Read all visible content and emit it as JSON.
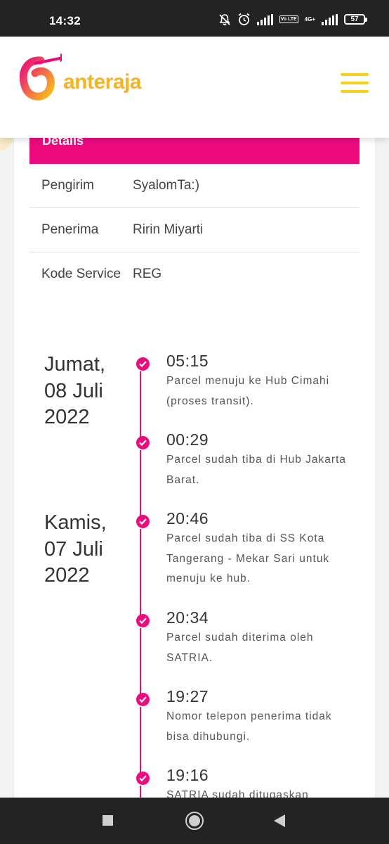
{
  "status": {
    "time": "14:32",
    "volte": "Vo LTE",
    "network": "4G+",
    "battery": "57"
  },
  "header": {
    "logo_text": "anteraja",
    "brand_colors": {
      "pink": "#ec0a7e",
      "yellow": "#f7b323"
    }
  },
  "details": {
    "title": "Details",
    "rows": [
      {
        "label": "Pengirim",
        "value": "SyalomTa:)"
      },
      {
        "label": "Penerima",
        "value": "Ririn Miyarti"
      },
      {
        "label": "Kode Service",
        "value": "REG"
      }
    ]
  },
  "timeline": {
    "dates": [
      {
        "text": "Jumat, 08 Juli 2022"
      },
      {
        "text": "Kamis, 07 Juli 2022"
      }
    ],
    "events": [
      {
        "time": "05:15",
        "desc": "Parcel menuju ke Hub Cimahi (proses transit)."
      },
      {
        "time": "00:29",
        "desc": "Parcel sudah tiba di Hub Jakarta Barat."
      },
      {
        "time": "20:46",
        "desc": "Parcel sudah tiba di SS Kota Tangerang - Mekar Sari untuk menuju ke hub."
      },
      {
        "time": "20:34",
        "desc": "Parcel sudah diterima oleh SATRIA."
      },
      {
        "time": "19:27",
        "desc": "Nomor telepon penerima tidak bisa dihubungi."
      },
      {
        "time": "19:16",
        "desc": "SATRIA sudah ditugaskan"
      }
    ]
  },
  "navbar": {
    "icons": [
      "recents-icon",
      "home-icon",
      "back-icon"
    ]
  }
}
